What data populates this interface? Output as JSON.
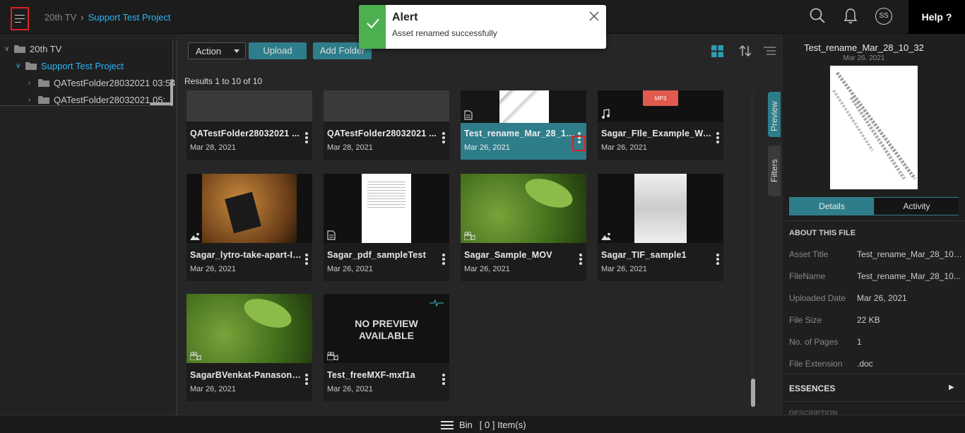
{
  "header": {
    "breadcrumb_root": "20th TV",
    "breadcrumb_current": "Support Test Project",
    "avatar_initials": "SS",
    "help_label": "Help ?"
  },
  "toast": {
    "title": "Alert",
    "message": "Asset renamed successfully",
    "status_color": "#4caf50"
  },
  "tree": {
    "root": "20th TV",
    "project": "Support Test Project",
    "folders": [
      "QATestFolder28032021 03:54",
      "QATestFolder28032021 05:..."
    ]
  },
  "toolbar": {
    "action_label": "Action",
    "upload_label": "Upload",
    "add_folder_label": "Add Folder"
  },
  "results_text": "Results 1 to 10 of 10",
  "assets": [
    {
      "name": "QATestFolder28032021 ...",
      "date": "Mar 28, 2021",
      "type": "folder"
    },
    {
      "name": "QATestFolder28032021 ...",
      "date": "Mar 28, 2021",
      "type": "folder"
    },
    {
      "name": "Test_rename_Mar_28_10_32",
      "date": "Mar 26, 2021",
      "type": "document",
      "selected": true
    },
    {
      "name": "Sagar_FIle_Example_WA...",
      "date": "Mar 26, 2021",
      "type": "audio"
    },
    {
      "name": "Sagar_lytro-take-apart-I2...",
      "date": "Mar 26, 2021",
      "type": "image"
    },
    {
      "name": "Sagar_pdf_sampleTest",
      "date": "Mar 26, 2021",
      "type": "document"
    },
    {
      "name": "Sagar_Sample_MOV",
      "date": "Mar 26, 2021",
      "type": "video"
    },
    {
      "name": "Sagar_TIF_sample1",
      "date": "Mar 26, 2021",
      "type": "image"
    },
    {
      "name": "SagarBVenkat-Panasoni...",
      "date": "Mar 26, 2021",
      "type": "video"
    },
    {
      "name": "Test_freeMXF-mxf1a",
      "date": "Mar 26, 2021",
      "type": "video"
    }
  ],
  "no_preview": {
    "line1": "NO PREVIEW",
    "line2": "AVAILABLE"
  },
  "mp3_badge": "MP3",
  "side_tabs": {
    "preview": "Preview",
    "filters": "Filters"
  },
  "details_panel": {
    "title": "Test_rename_Mar_28_10_32",
    "date": "Mar 26, 2021",
    "tab_details": "Details",
    "tab_activity": "Activity",
    "section_title": "ABOUT THIS FILE",
    "fields": [
      {
        "label": "Asset Title",
        "value": "Test_rename_Mar_28_10_32"
      },
      {
        "label": "FileName",
        "value": "Test_rename_Mar_28_10..."
      },
      {
        "label": "Uploaded Date",
        "value": "Mar 26, 2021"
      },
      {
        "label": "File Size",
        "value": "22 KB"
      },
      {
        "label": "No. of Pages",
        "value": "1"
      },
      {
        "label": "File Extension",
        "value": ".doc"
      }
    ],
    "essences_label": "ESSENCES",
    "description_label": "DESCRIPTION"
  },
  "bin": {
    "label": "Bin",
    "count_text": "[ 0 ] Item(s)"
  },
  "colors": {
    "accent": "#2e7d8a",
    "breadcrumb_active": "#29b6f6",
    "highlight_box": "#e02020"
  }
}
